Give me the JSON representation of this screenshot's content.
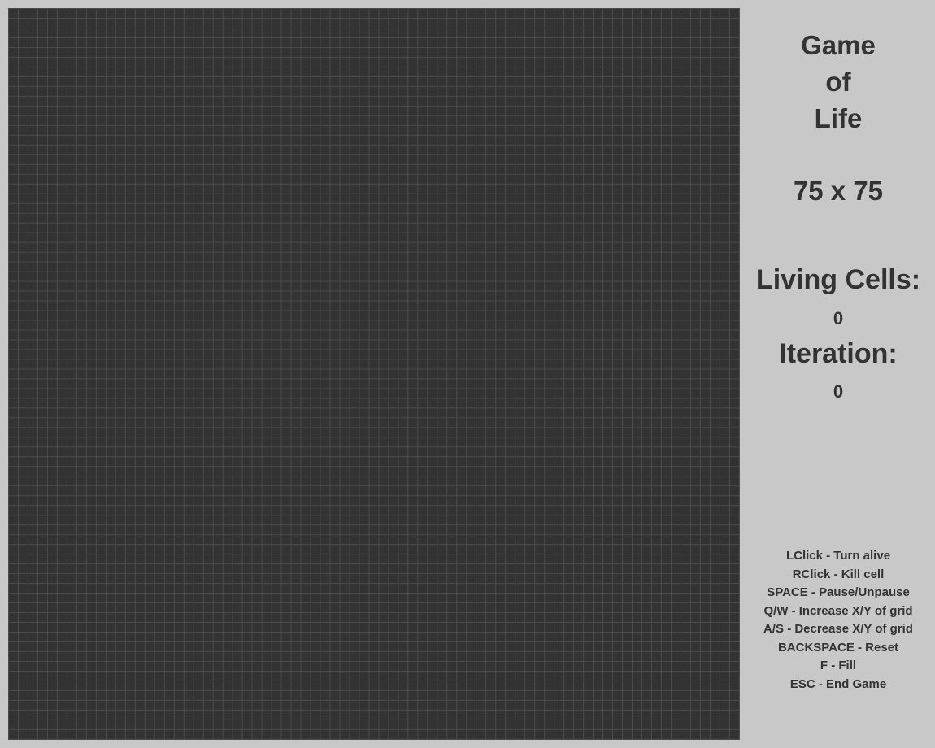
{
  "title": {
    "line1": "Game",
    "line2": "of",
    "line3": "Life"
  },
  "grid": {
    "size_label": "75 x 75",
    "columns": 75,
    "rows": 75,
    "cell_color": "#333333",
    "line_color": "#4a4a4a"
  },
  "stats": {
    "living_label": "Living Cells:",
    "living_value": "0",
    "iteration_label": "Iteration:",
    "iteration_value": "0"
  },
  "controls": [
    "LClick - Turn alive",
    "RClick - Kill cell",
    "SPACE - Pause/Unpause",
    "Q/W - Increase X/Y of grid",
    "A/S - Decrease X/Y of grid",
    "BACKSPACE - Reset",
    "F - Fill",
    "ESC - End Game"
  ],
  "colors": {
    "background": "#c8c8c8",
    "text": "#333333"
  }
}
